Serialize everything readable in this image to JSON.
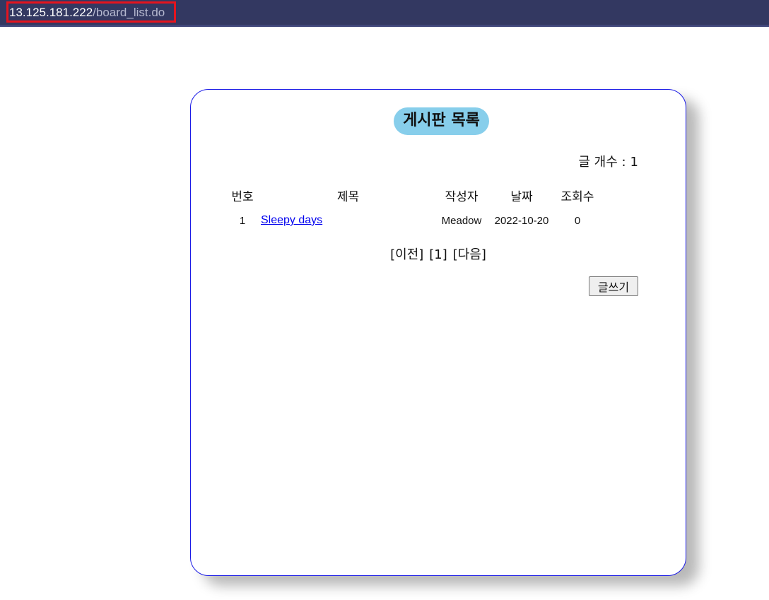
{
  "address_bar": {
    "host": "13.125.181.222",
    "path": "/board_list.do",
    "highlight_color": "#e5141e"
  },
  "board": {
    "title": "게시판 목록",
    "count_label": "글 개수 :",
    "count_value": "1",
    "columns": [
      "번호",
      "제목",
      "작성자",
      "날짜",
      "조회수"
    ],
    "rows": [
      {
        "no": "1",
        "title": "Sleepy days",
        "author": "Meadow",
        "date": "2022-10-20",
        "views": "0"
      }
    ],
    "pager": {
      "prev": "[이전]",
      "page": "[1]",
      "next": "[다음]"
    },
    "write_button": "글쓰기"
  },
  "colors": {
    "topbar": "#333861",
    "title_badge": "#87ceeb",
    "card_border": "#1a1ae6",
    "link": "#0000ee"
  }
}
